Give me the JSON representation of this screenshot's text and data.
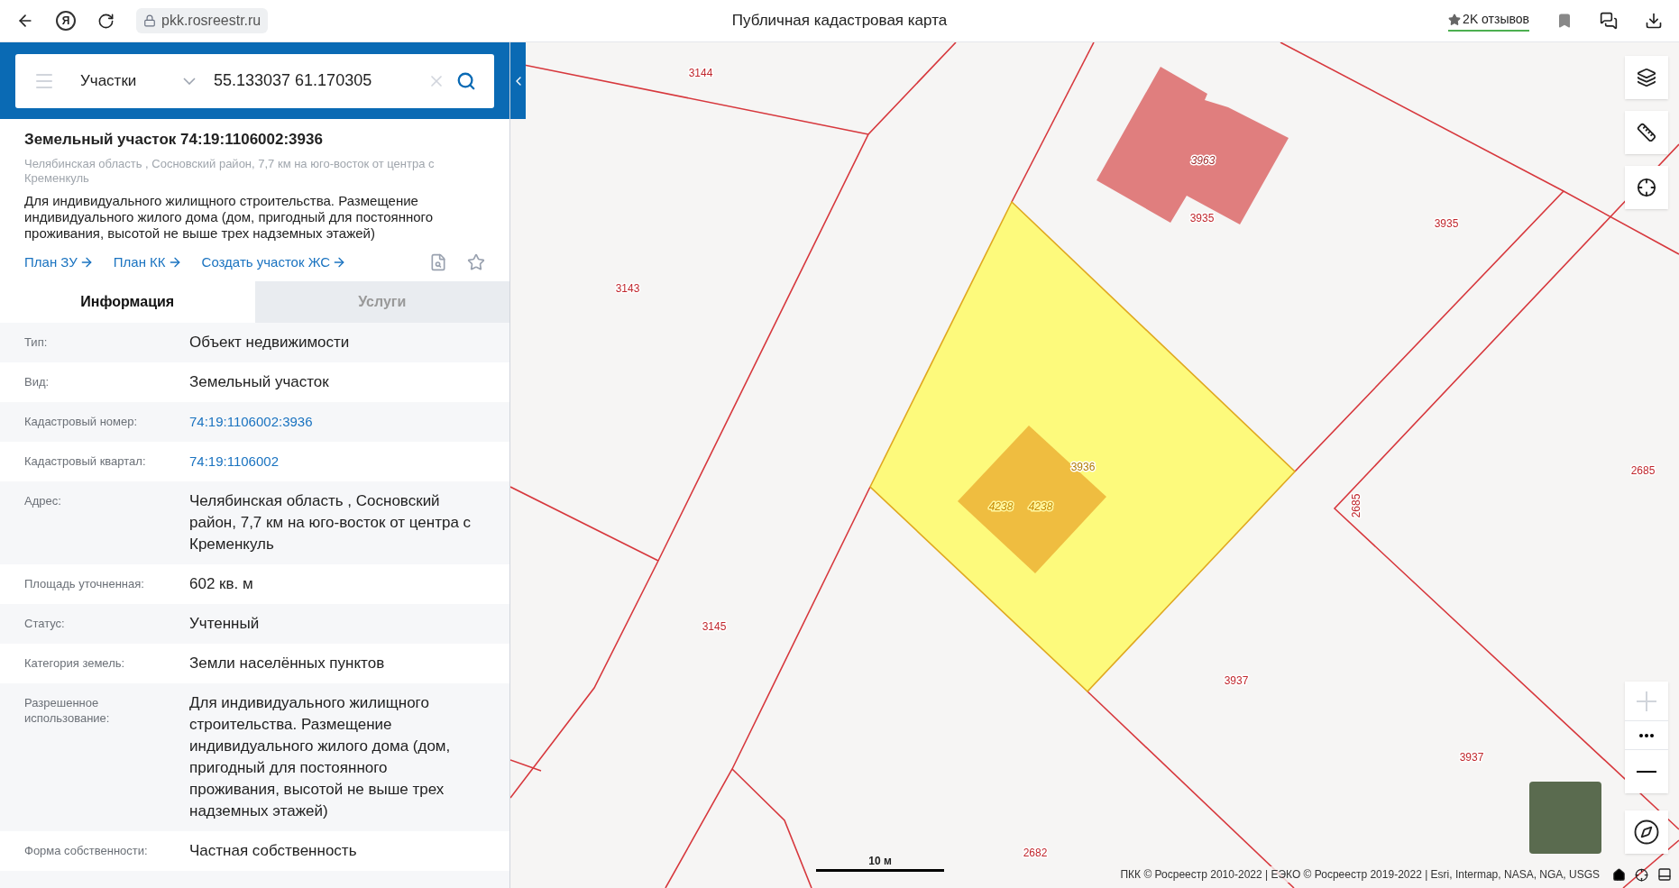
{
  "browser": {
    "logo_letter": "Я",
    "url": "pkk.rosreestr.ru",
    "title": "Публичная кадастровая карта",
    "reviews": "2K отзывов"
  },
  "search": {
    "category": "Участки",
    "value": "55.133037 61.170305"
  },
  "object": {
    "title": "Земельный участок 74:19:1106002:3936",
    "address": "Челябинская область , Сосновский район, 7,7 км на юго-восток от центра с Кременкуль",
    "description": "Для индивидуального жилищного строительства. Размещение индивидуального жилого дома (дом, пригодный для постоянного проживания, высотой не выше трех надземных этажей)",
    "links": [
      "План ЗУ",
      "План КК",
      "Создать участок ЖС"
    ]
  },
  "tabs": [
    {
      "label": "Информация",
      "selected": true
    },
    {
      "label": "Услуги",
      "selected": false
    }
  ],
  "info_rows": [
    {
      "label": "Тип:",
      "value": "Объект недвижимости",
      "kind": "text"
    },
    {
      "label": "Вид:",
      "value": "Земельный участок",
      "kind": "text"
    },
    {
      "label": "Кадастровый номер:",
      "value": "74:19:1106002:3936",
      "kind": "link"
    },
    {
      "label": "Кадастровый квартал:",
      "value": "74:19:1106002",
      "kind": "link"
    },
    {
      "label": "Адрес:",
      "value": "Челябинская область , Сосновский район, 7,7 км на юго-восток от центра с Кременкуль",
      "kind": "text"
    },
    {
      "label": "Площадь уточненная:",
      "value": "602 кв. м",
      "kind": "text"
    },
    {
      "label": "Статус:",
      "value": "Учтенный",
      "kind": "text"
    },
    {
      "label": "Категория земель:",
      "value": "Земли населённых пунктов",
      "kind": "text"
    },
    {
      "label": "Разрешенное использование:",
      "value": "Для индивидуального жилищного строительства. Размещение индивидуального жилого дома (дом, пригодный для постоянного проживания, высотой не выше трех надземных этажей)",
      "kind": "text"
    },
    {
      "label": "Форма собственности:",
      "value": "Частная собственность",
      "kind": "text"
    }
  ],
  "map": {
    "labels": [
      {
        "text": "3144",
        "kind": "parcel"
      },
      {
        "text": "3143",
        "kind": "parcel"
      },
      {
        "text": "3963",
        "kind": "building"
      },
      {
        "text": "3935",
        "kind": "parcel"
      },
      {
        "text": "3935",
        "kind": "parcel"
      },
      {
        "text": "3936",
        "kind": "selected"
      },
      {
        "text": "4238",
        "kind": "structure"
      },
      {
        "text": "4238",
        "kind": "structure"
      },
      {
        "text": "2685",
        "kind": "vertical"
      },
      {
        "text": "2685",
        "kind": "parcel"
      },
      {
        "text": "3145",
        "kind": "parcel"
      },
      {
        "text": "3937",
        "kind": "parcel"
      },
      {
        "text": "3937",
        "kind": "parcel"
      },
      {
        "text": "2682",
        "kind": "parcel"
      }
    ],
    "scale_label": "10 м",
    "attribution": "ПКК © Росреестр 2010-2022 | ЕЭКО © Росреестр 2019-2022 | Esri, Intermap, NASA, NGA, USGS"
  }
}
